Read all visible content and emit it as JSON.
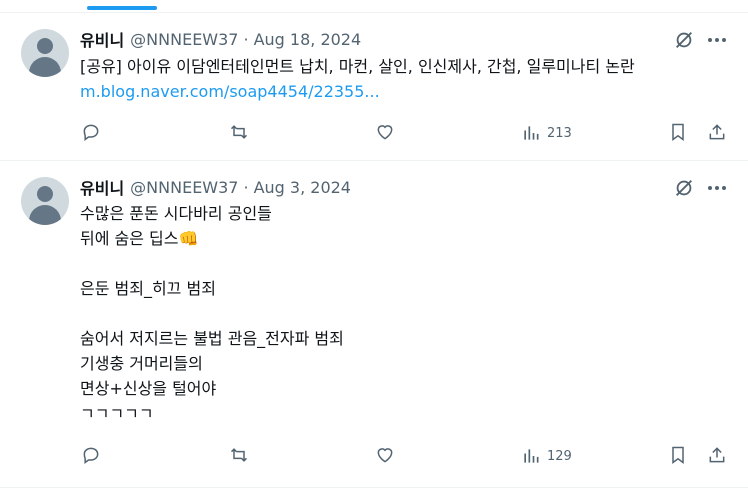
{
  "tweets": [
    {
      "name": "유비니",
      "handle": "@NNNEEW37",
      "separator": "·",
      "date": "Aug 18, 2024",
      "text_lines": [
        "[공유] 아이유 이담엔터테인먼트 납치, 마컨, 살인, 인신제사, 간첩, 일루미나티 논란"
      ],
      "link": "m.blog.naver.com/soap4454/22355...",
      "views": "213"
    },
    {
      "name": "유비니",
      "handle": "@NNNEEW37",
      "separator": "·",
      "date": "Aug 3, 2024",
      "text_lines": [
        "수많은 푼돈 시다바리 공인들",
        "뒤에 숨은 딥스👊",
        "",
        "은둔 범죄_히끄 범죄",
        "",
        "숨어서 저지르는 불법 관음_전자파 범죄",
        "기생충 거머리들의",
        "면상+신상을 털어야",
        "ㄱㄱㄱㄱㄱ"
      ],
      "link": "",
      "views": "129"
    }
  ],
  "icons": {
    "reply": "reply-icon",
    "retweet": "retweet-icon",
    "like": "heart-icon",
    "views": "views-icon",
    "bookmark": "bookmark-icon",
    "share": "share-icon",
    "grok": "grok-icon",
    "more": "more-icon"
  },
  "colors": {
    "accent": "#1d9bf0",
    "secondary_text": "#536471",
    "border": "#eff3f4"
  }
}
